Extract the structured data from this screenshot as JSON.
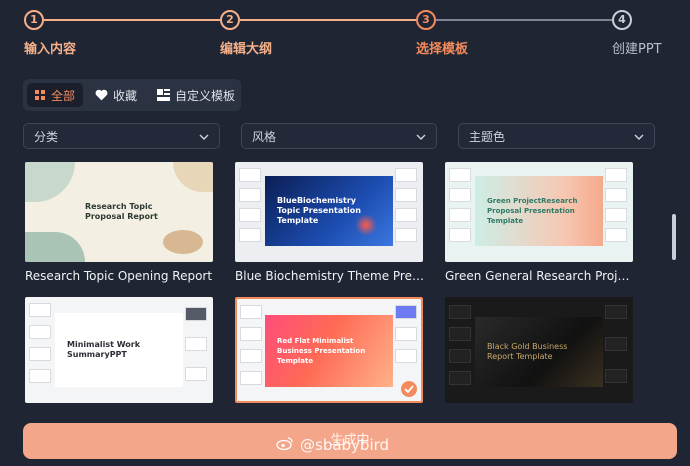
{
  "colors": {
    "accent": "#f58a5c",
    "done": "#f5b08a",
    "pending": "#9aa2b1",
    "bg": "#1f2533"
  },
  "steps": [
    {
      "num": "1",
      "label": "输入内容",
      "state": "done"
    },
    {
      "num": "2",
      "label": "编辑大纲",
      "state": "done"
    },
    {
      "num": "3",
      "label": "选择模板",
      "state": "active"
    },
    {
      "num": "4",
      "label": "创建PPT",
      "state": "pending"
    }
  ],
  "tabs": [
    {
      "label": "全部",
      "icon": "grid-icon",
      "active": true
    },
    {
      "label": "收藏",
      "icon": "heart-icon",
      "active": false
    },
    {
      "label": "自定义模板",
      "icon": "template-icon",
      "active": false
    }
  ],
  "filters": [
    {
      "label": "分类"
    },
    {
      "label": "风格"
    },
    {
      "label": "主题色"
    }
  ],
  "templates": [
    {
      "title": "Research Topic Opening Report",
      "slide_text": "Research Topic Proposal Report",
      "selected": false
    },
    {
      "title": "Blue Biochemistry Theme Presen…",
      "slide_text": "BlueBiochemistry Topic Presentation Template",
      "selected": false
    },
    {
      "title": "Green General Research Project …",
      "slide_text": "Green ProjectResearch Proposal Presentation Template",
      "selected": false
    },
    {
      "title": "",
      "slide_text": "Minimalist Work SummaryPPT",
      "selected": false
    },
    {
      "title": "",
      "slide_text": "Red Flat Minimalist Business Presentation Template",
      "selected": true
    },
    {
      "title": "",
      "slide_text": "Black Gold Business Report Template",
      "selected": false
    }
  ],
  "generate_button": {
    "label": "生成中"
  },
  "watermark": {
    "text": "@sbabybird"
  }
}
